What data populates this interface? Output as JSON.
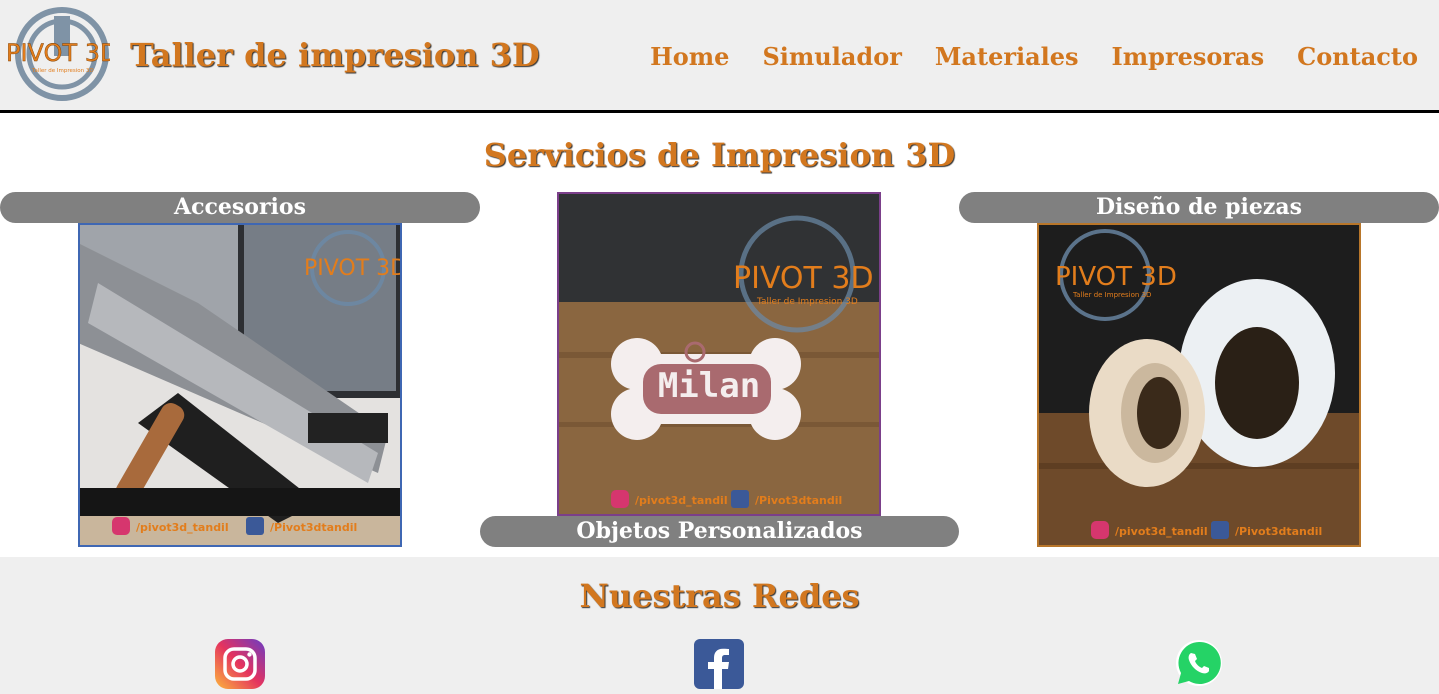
{
  "header": {
    "title": "Taller de impresion 3D",
    "logo_text": "PIVOT 3D",
    "logo_subtext": "Taller de Impresion 3D"
  },
  "nav": {
    "items": [
      {
        "label": "Home"
      },
      {
        "label": "Simulador"
      },
      {
        "label": "Materiales"
      },
      {
        "label": "Impresoras"
      },
      {
        "label": "Contacto"
      }
    ]
  },
  "services": {
    "title": "Servicios de Impresion 3D",
    "cards": [
      {
        "label": "Accesorios"
      },
      {
        "label": "Objetos Personalizados"
      },
      {
        "label": "Diseño de piezas"
      }
    ],
    "watermark_brand": "PIVOT 3D",
    "watermark_sub": "Taller de Impresion 3D",
    "instagram_handle": "/pivot3d_tandil",
    "facebook_handle": "/Pivot3dtandil",
    "tag_text": "Milan"
  },
  "footer": {
    "title": "Nuestras Redes"
  },
  "colors": {
    "accent": "#d2771f",
    "label_bg": "#808080",
    "header_bg": "#efefef",
    "border_blue": "#3f67b3",
    "border_purple": "#7b3f8a",
    "border_orange": "#b8762a"
  },
  "icons": [
    "instagram-icon",
    "facebook-icon",
    "whatsapp-icon"
  ]
}
